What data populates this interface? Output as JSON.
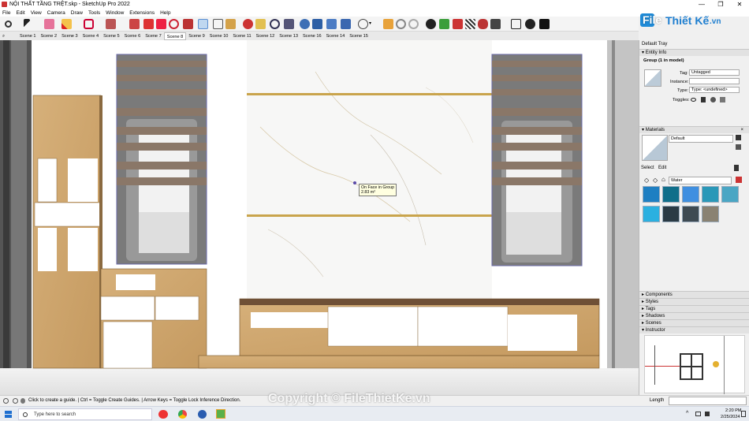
{
  "window": {
    "title": "NỘI THẤT TẦNG TRỆT.skp - SketchUp Pro 2022",
    "min": "—",
    "max": "❐",
    "close": "✕"
  },
  "menu": [
    "File",
    "Edit",
    "View",
    "Camera",
    "Draw",
    "Tools",
    "Window",
    "Extensions",
    "Help"
  ],
  "scenes": [
    "Scene 1",
    "Scene 2",
    "Scene 3",
    "Scene 4",
    "Scene 5",
    "Scene 6",
    "Scene 7",
    "Scene 8",
    "Scene 9",
    "Scene 10",
    "Scene 11",
    "Scene 12",
    "Scene 13",
    "Scene 16",
    "Scene 14",
    "Scene 15"
  ],
  "active_scene": "Scene 8",
  "viewport": {
    "tooltip_line1": "On Face in Group",
    "tooltip_line2": "2.83 m²"
  },
  "tray": {
    "title": "Default Tray",
    "entity_info": {
      "header": "Entity Info",
      "selection": "Group (1 in model)",
      "tag_label": "Tag:",
      "tag_value": "Untagged",
      "instance_label": "Instance:",
      "instance_value": "",
      "type_label": "Type:",
      "type_value": "Type: <undefined>",
      "toggles_label": "Toggles:"
    },
    "materials": {
      "header": "Materials",
      "current": "Default",
      "tab_select": "Select",
      "tab_edit": "Edit",
      "library": "Water",
      "swatch_colors": [
        "#1e7fc2",
        "#0f6e8a",
        "#3f8fe0",
        "#2a98b8",
        "#4aa6c4",
        "#2bb0e0",
        "#2a3a44",
        "#3e4a52",
        "#8a8272"
      ]
    },
    "panels": [
      "Components",
      "Styles",
      "Tags",
      "Shadows",
      "Scenes",
      "Instructor"
    ]
  },
  "status": {
    "hint": "Click to create a guide. | Ctrl = Toggle Create Guides. | Arrow Keys = Toggle Lock Inference Direction.",
    "measure_label": "Length"
  },
  "taskbar": {
    "search": "Type here to search",
    "time": "2:20 PM",
    "date": "2/25/2024"
  },
  "watermark": {
    "logo_a": "File",
    "logo_b": "Thiết Kế",
    "logo_c": ".vn",
    "copyright": "Copyright © FileThietKe.vn"
  },
  "icons": [
    "search-icon",
    "select-arrow-icon",
    "eraser-icon",
    "pencil-icon",
    "shape-icon",
    "push-pull-icon",
    "move-icon",
    "rotate-icon",
    "tape-measure-icon",
    "orbit-icon",
    "zoom-icon",
    "extension-icon",
    "user-icon",
    "warning-icon",
    "help-icon",
    "close-icon"
  ]
}
